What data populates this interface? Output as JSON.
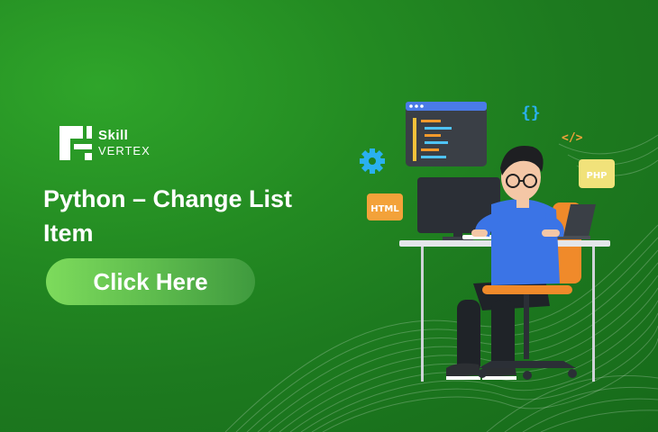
{
  "brand": {
    "line1": "Skill",
    "line2": "VERTEX"
  },
  "headline": "Python – Change List Item",
  "cta": {
    "label": "Click Here"
  },
  "badges": {
    "html": "HTML",
    "php": "PHP",
    "braces": "{}",
    "code": "</>"
  },
  "colors": {
    "background": "#1f7f20",
    "button": "#6fcf57",
    "accent_orange": "#f3a23a",
    "shirt_blue": "#3b74e6"
  }
}
